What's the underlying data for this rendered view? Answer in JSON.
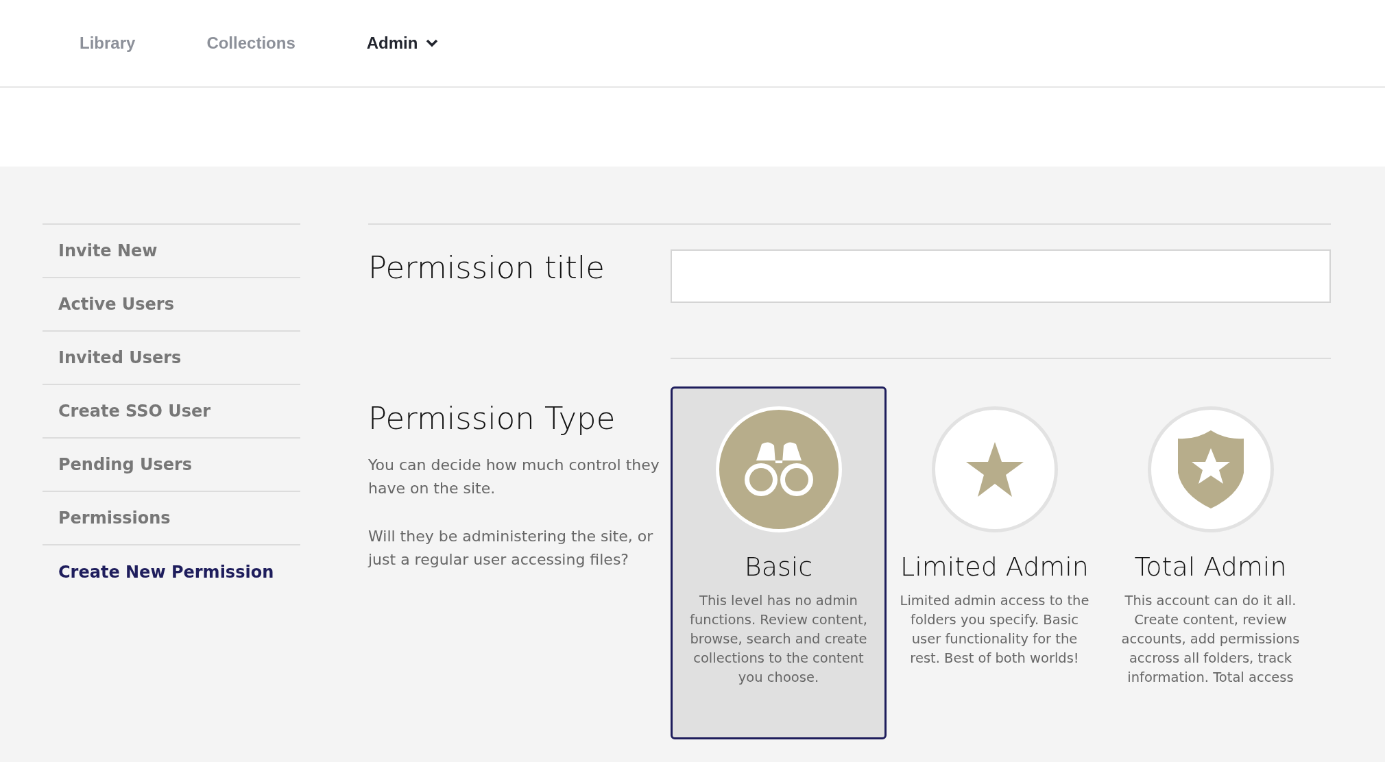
{
  "nav": [
    {
      "label": "Library",
      "selected": false,
      "dropdown": false
    },
    {
      "label": "Collections",
      "selected": false,
      "dropdown": false
    },
    {
      "label": "Admin",
      "selected": true,
      "dropdown": true
    }
  ],
  "sidebar": {
    "items": [
      {
        "label": "Invite New",
        "selected": false
      },
      {
        "label": "Active Users",
        "selected": false
      },
      {
        "label": "Invited Users",
        "selected": false
      },
      {
        "label": "Create SSO User",
        "selected": false
      },
      {
        "label": "Pending Users",
        "selected": false
      },
      {
        "label": "Permissions",
        "selected": false
      },
      {
        "label": "Create New Permission",
        "selected": true
      }
    ]
  },
  "title_field": {
    "label": "Permission title"
  },
  "permission_type": {
    "heading": "Permission Type",
    "paragraphs": [
      "You can decide how much control they have on the site.",
      "Will they be administering the site, or just a regular user accessing files?"
    ],
    "options": [
      {
        "kind": "binoculars",
        "title": "Basic",
        "description": "This level has no admin functions. Review content, browse, search and create collections to the content you choose.",
        "selected": true
      },
      {
        "kind": "star",
        "title": "Limited Admin",
        "description": "Limited admin access to the folders you specify. Basic user functionality for the rest. Best of both worlds!",
        "selected": false
      },
      {
        "kind": "shield",
        "title": "Total Admin",
        "description": "This account can do it all. Create content, review accounts, add permissions accross all folders, track information. Total access",
        "selected": false
      }
    ]
  }
}
